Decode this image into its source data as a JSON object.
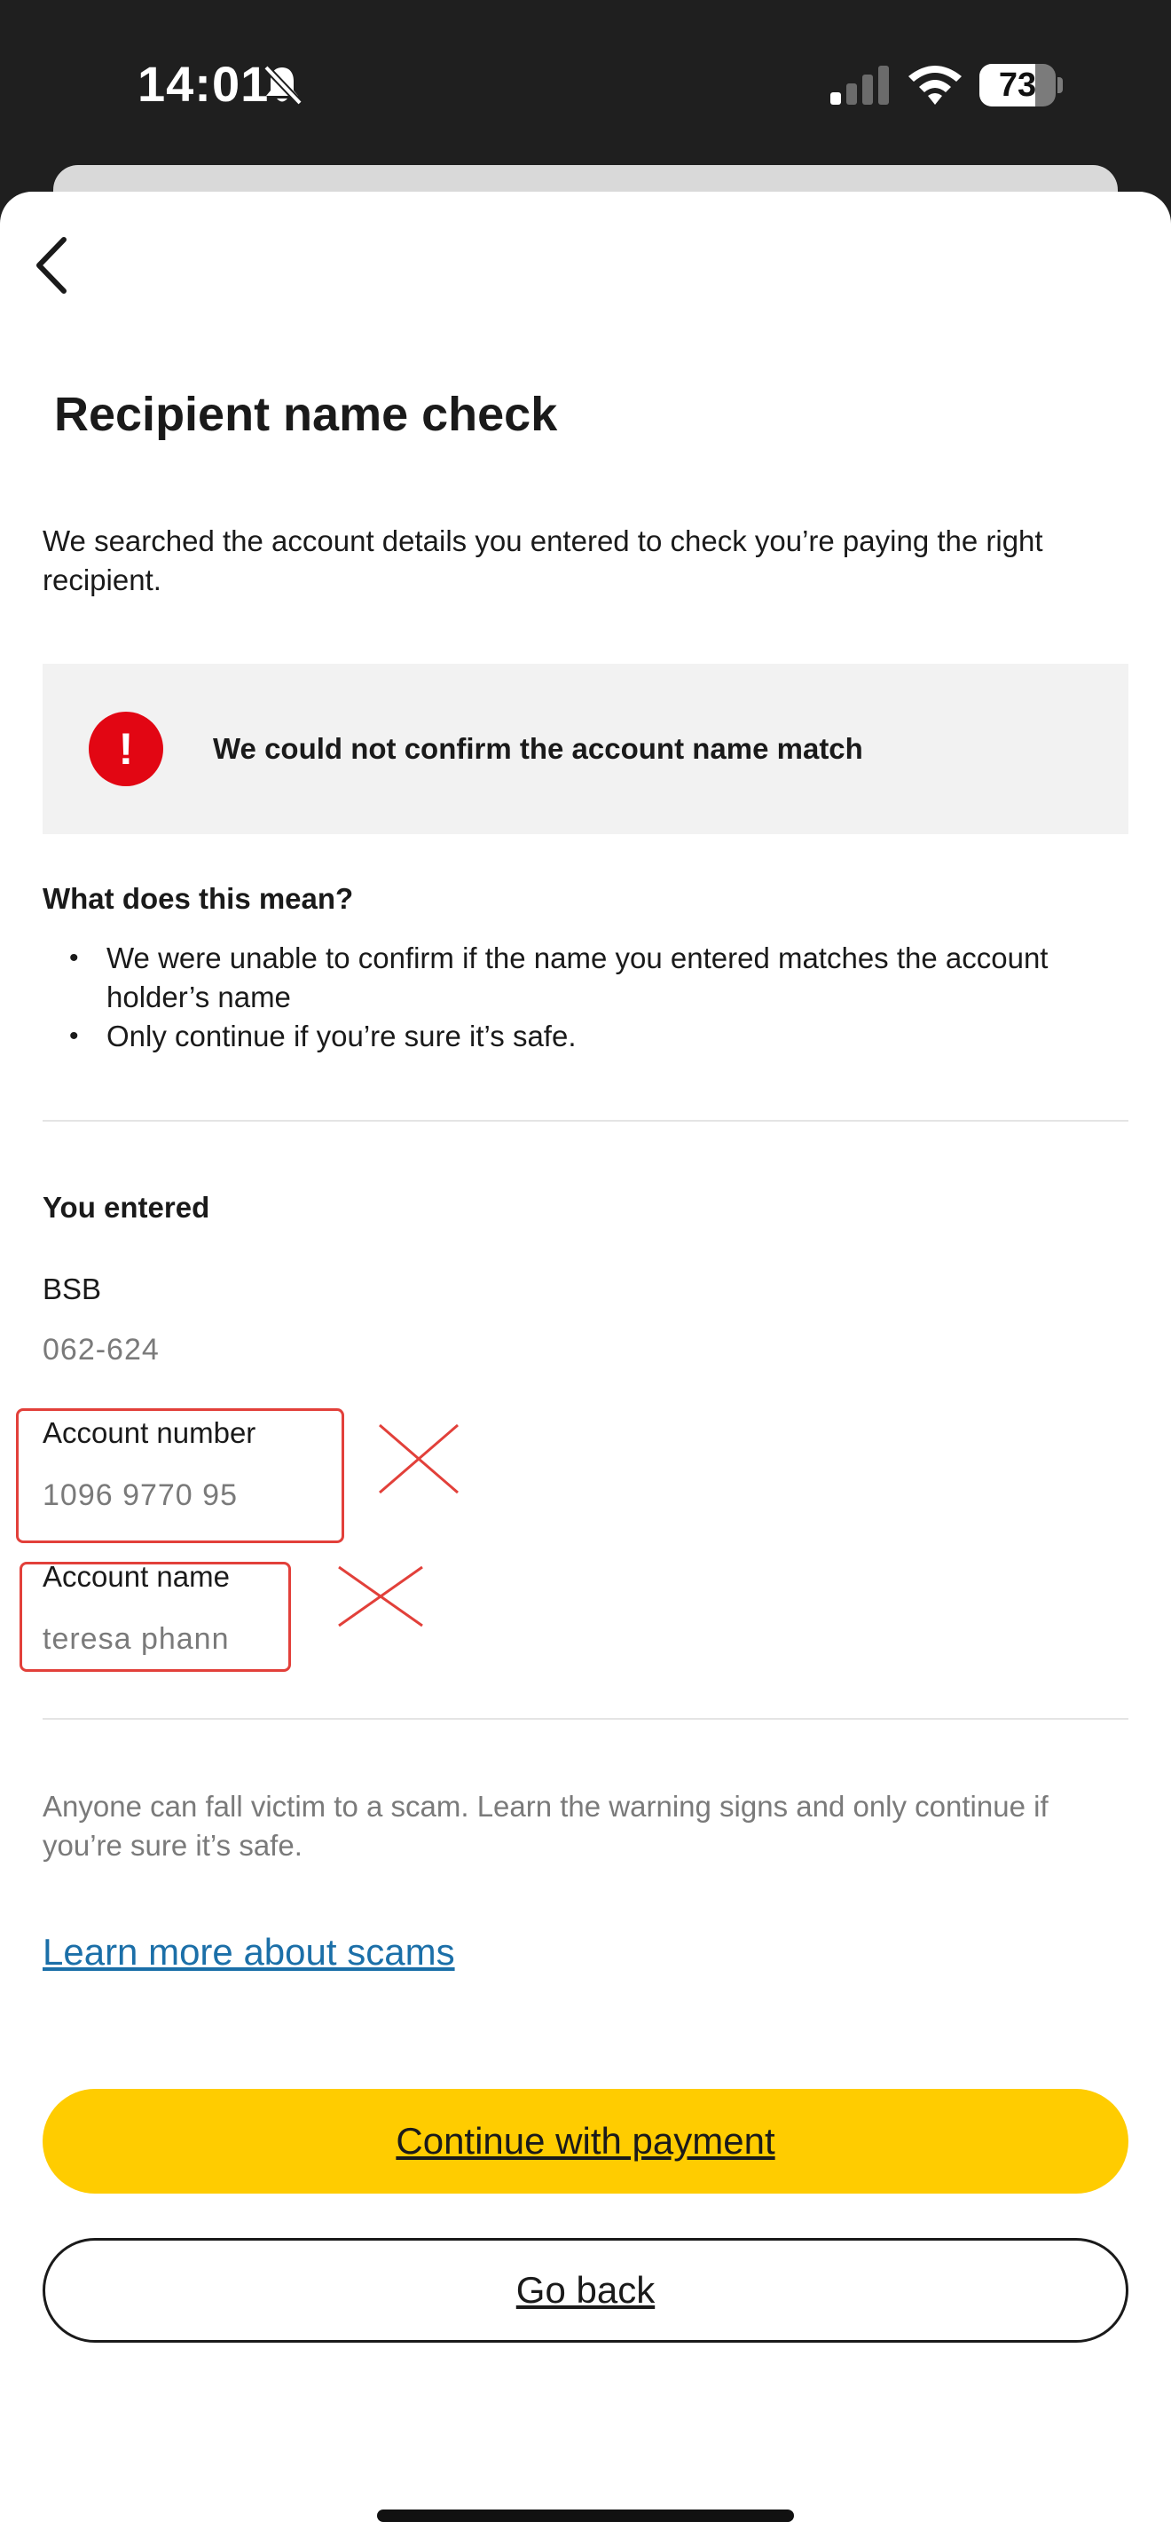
{
  "status_bar": {
    "time": "14:01",
    "battery": "73",
    "battery_level": 0.73
  },
  "page": {
    "title": "Recipient name check",
    "intro": "We searched the account details you entered to check you’re paying the right recipient."
  },
  "alert": {
    "text": "We could not confirm the account name match",
    "icon": "!",
    "color": "#e20613"
  },
  "meaning": {
    "heading": "What does this mean?",
    "bullets": [
      "We were unable to confirm if the name you entered matches the account holder’s name",
      "Only continue if you’re sure it’s safe."
    ]
  },
  "entered": {
    "heading": "You entered",
    "bsb_label": "BSB",
    "bsb_value": "062-624",
    "account_number_label": "Account number",
    "account_number_value": "1096 9770 95",
    "account_name_label": "Account name",
    "account_name_value": "teresa phann"
  },
  "scam": {
    "note": "Anyone can fall victim to a scam. Learn the warning signs and only continue if you’re sure it’s safe.",
    "link": "Learn more about scams"
  },
  "actions": {
    "continue_label": "Continue with payment",
    "goback_label": "Go back"
  },
  "colors": {
    "accent_yellow": "#ffcc00",
    "link_blue": "#1b6fa8",
    "error_red": "#e20613",
    "annotation_red": "#e2403a"
  }
}
